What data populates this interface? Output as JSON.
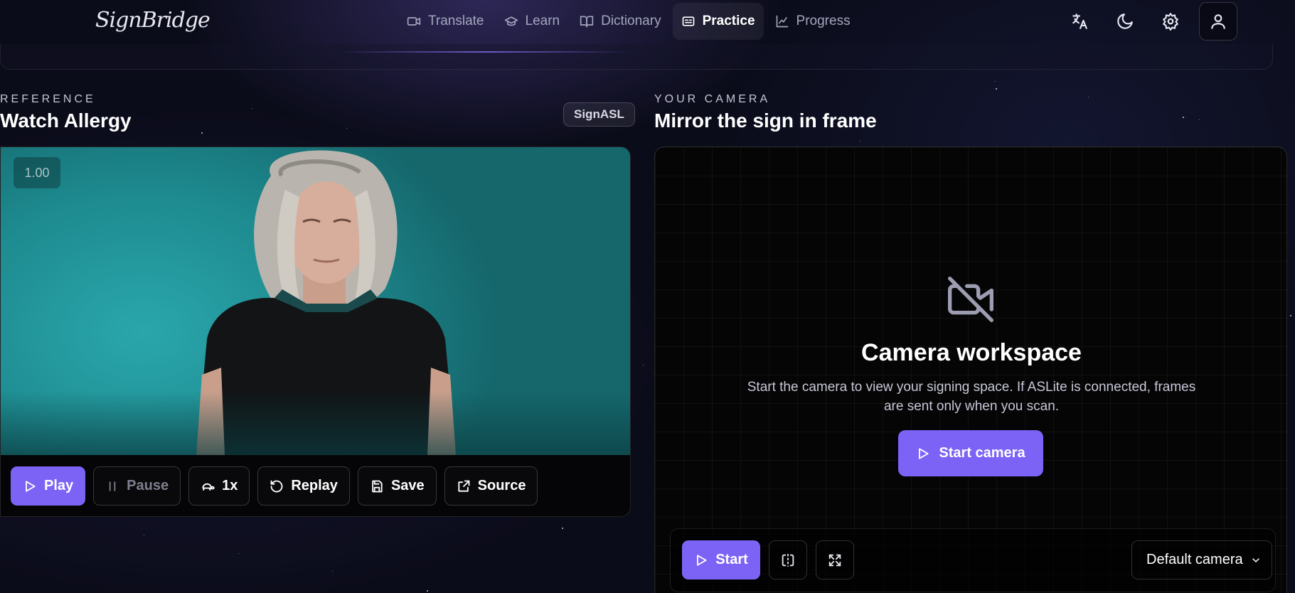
{
  "app": {
    "logo_text": "SignBridge"
  },
  "nav": {
    "items": [
      {
        "label": "Translate",
        "icon": "video-icon",
        "active": false
      },
      {
        "label": "Learn",
        "icon": "graduation-cap-icon",
        "active": false
      },
      {
        "label": "Dictionary",
        "icon": "book-open-icon",
        "active": false
      },
      {
        "label": "Practice",
        "icon": "cards-icon",
        "active": true
      },
      {
        "label": "Progress",
        "icon": "line-chart-icon",
        "active": false
      }
    ]
  },
  "header_actions": {
    "language": "translate-icon",
    "theme": "moon-icon",
    "settings": "gear-icon",
    "account": "user-icon"
  },
  "reference": {
    "kicker": "REFERENCE",
    "title": "Watch Allergy",
    "badge": "SignASL",
    "speed_readout": "1.00",
    "controls": {
      "play": "Play",
      "pause": "Pause",
      "speed": "1x",
      "replay": "Replay",
      "save": "Save",
      "source": "Source"
    }
  },
  "camera": {
    "kicker": "YOUR CAMERA",
    "title": "Mirror the sign in frame",
    "workspace_title": "Camera workspace",
    "workspace_desc": "Start the camera to view your signing space. If ASLite is connected, frames are sent only when you scan.",
    "start_camera_label": "Start camera",
    "start_label": "Start",
    "device_selected": "Default camera"
  },
  "colors": {
    "accent": "#7c63f5",
    "background": "#0b0c1a",
    "video_bg": "#1d8a8f"
  }
}
